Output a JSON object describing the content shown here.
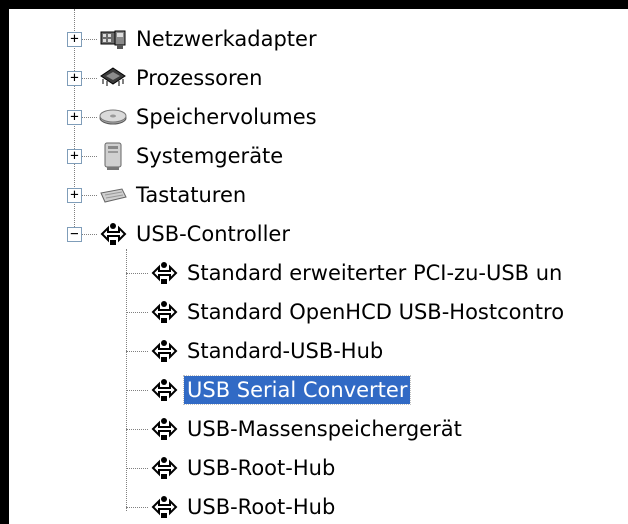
{
  "tree": {
    "categories": [
      {
        "label": "Netzwerkadapter",
        "expander": "+",
        "icon": "network-adapter-icon"
      },
      {
        "label": "Prozessoren",
        "expander": "+",
        "icon": "processor-icon"
      },
      {
        "label": "Speichervolumes",
        "expander": "+",
        "icon": "storage-volume-icon"
      },
      {
        "label": "Systemgeräte",
        "expander": "+",
        "icon": "system-device-icon"
      },
      {
        "label": "Tastaturen",
        "expander": "+",
        "icon": "keyboard-icon"
      },
      {
        "label": "USB-Controller",
        "expander": "−",
        "icon": "usb-icon"
      }
    ],
    "usb_children": [
      {
        "label": "Standard erweiterter PCI-zu-USB un",
        "icon": "usb-icon"
      },
      {
        "label": "Standard OpenHCD USB-Hostcontro",
        "icon": "usb-icon"
      },
      {
        "label": "Standard-USB-Hub",
        "icon": "usb-icon"
      },
      {
        "label": "USB Serial Converter",
        "icon": "usb-icon",
        "selected": true
      },
      {
        "label": "USB-Massenspeichergerät",
        "icon": "usb-icon"
      },
      {
        "label": "USB-Root-Hub",
        "icon": "usb-icon"
      },
      {
        "label": "USB-Root-Hub",
        "icon": "usb-icon"
      }
    ]
  },
  "colors": {
    "selection": "#316ac5",
    "selection_text": "#ffffff"
  }
}
